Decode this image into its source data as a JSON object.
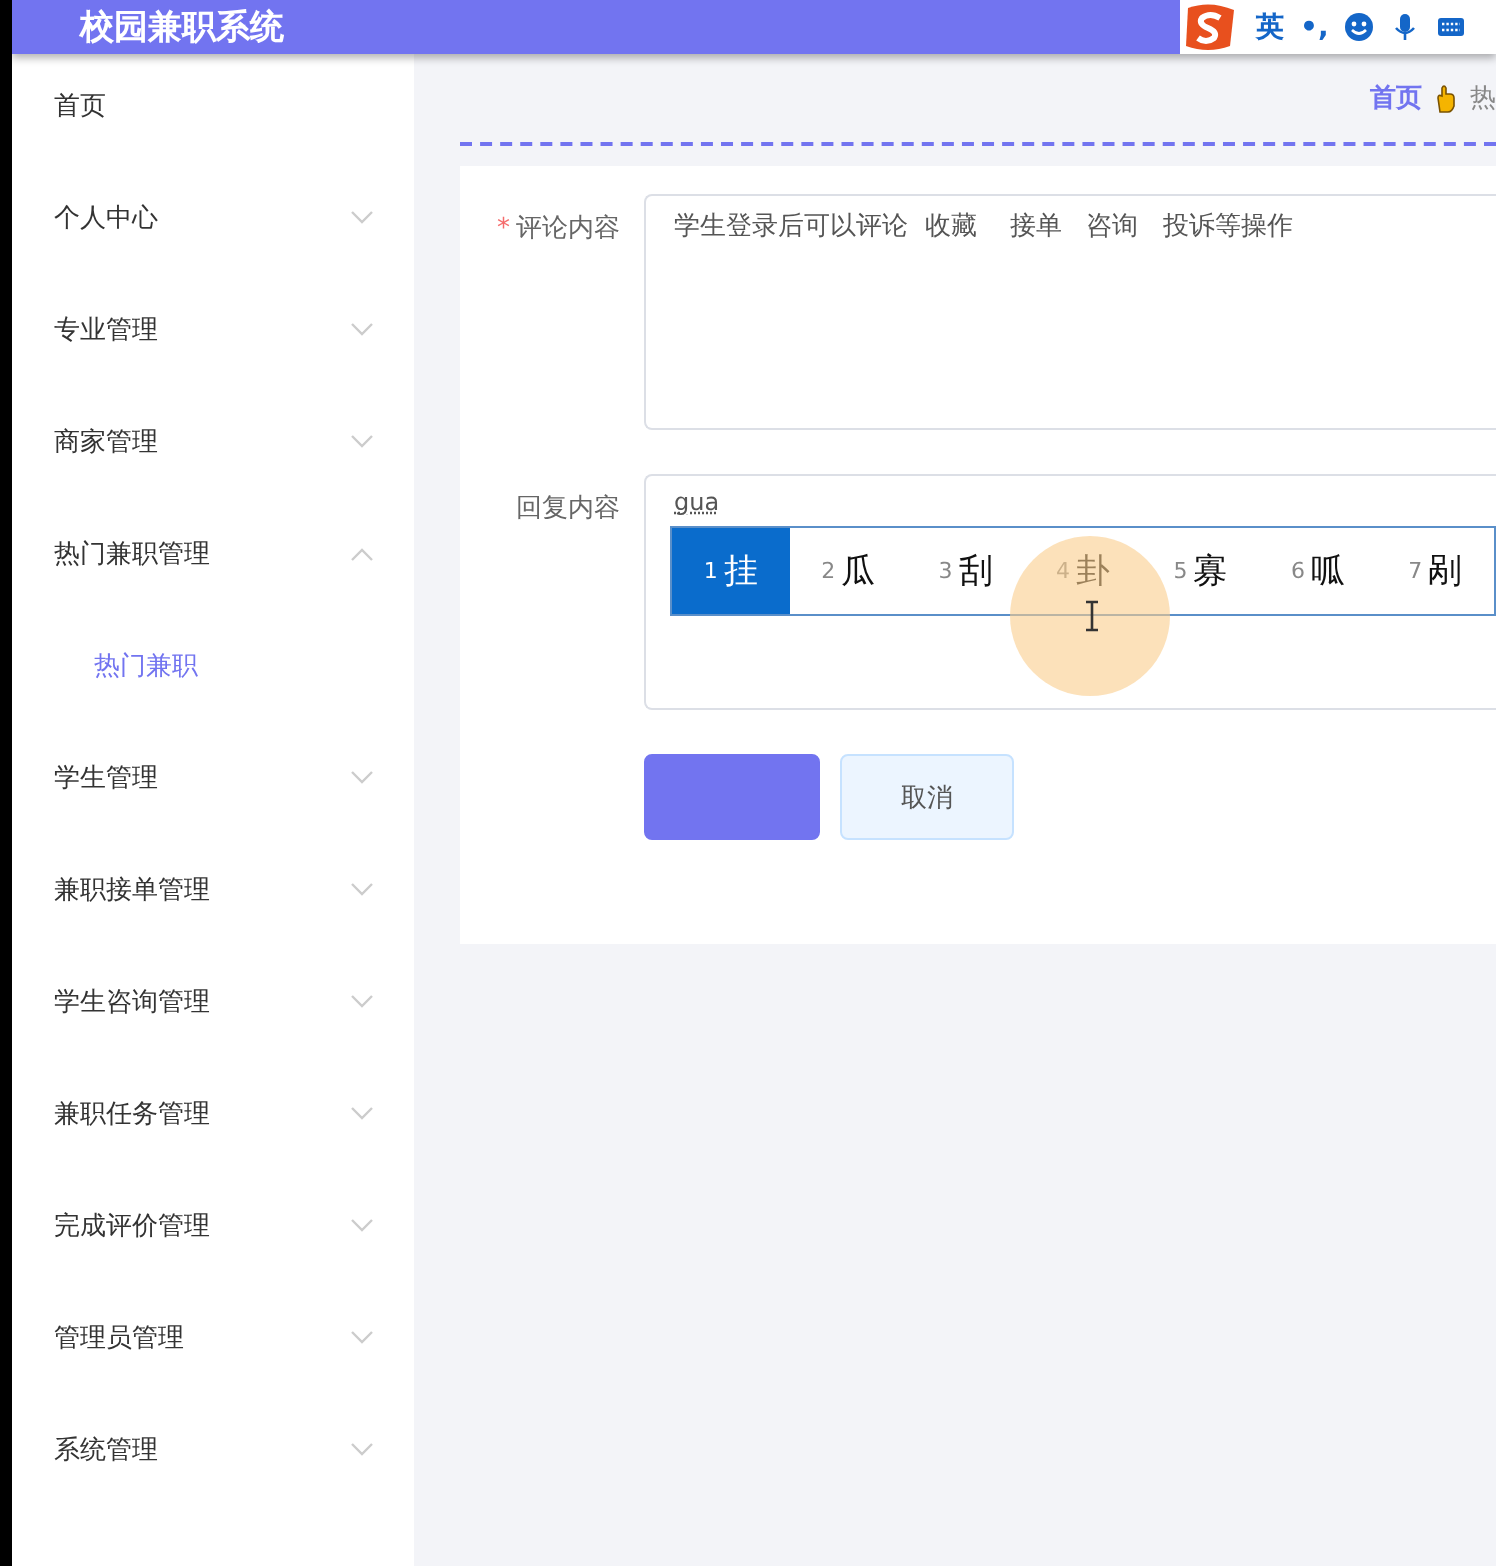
{
  "header": {
    "title": "校园兼职系统",
    "ime_toolbar": {
      "mode": "英",
      "punctuation": "•,"
    }
  },
  "sidebar": {
    "items": [
      {
        "label": "首页",
        "kind": "link"
      },
      {
        "label": "个人中心",
        "kind": "group",
        "expanded": false
      },
      {
        "label": "专业管理",
        "kind": "group",
        "expanded": false
      },
      {
        "label": "商家管理",
        "kind": "group",
        "expanded": false
      },
      {
        "label": "热门兼职管理",
        "kind": "group",
        "expanded": true,
        "children": [
          {
            "label": "热门兼职",
            "selected": true
          }
        ]
      },
      {
        "label": "学生管理",
        "kind": "group",
        "expanded": false
      },
      {
        "label": "兼职接单管理",
        "kind": "group",
        "expanded": false
      },
      {
        "label": "学生咨询管理",
        "kind": "group",
        "expanded": false
      },
      {
        "label": "兼职任务管理",
        "kind": "group",
        "expanded": false
      },
      {
        "label": "完成评价管理",
        "kind": "group",
        "expanded": false
      },
      {
        "label": "管理员管理",
        "kind": "group",
        "expanded": false
      },
      {
        "label": "系统管理",
        "kind": "group",
        "expanded": false
      }
    ]
  },
  "breadcrumb": {
    "items": [
      "首页",
      "热"
    ]
  },
  "form": {
    "fields": [
      {
        "label": "评论内容",
        "required_mark": "*",
        "value": "学生登录后可以评论  收藏    接单   咨询   投诉等操作"
      },
      {
        "label": "回复内容",
        "value": "gua"
      }
    ],
    "buttons": [
      {
        "kind": "primary"
      },
      {
        "kind": "default",
        "label": "取消"
      }
    ]
  },
  "ime_candidates": [
    {
      "index": "1",
      "text": "挂",
      "selected": true
    },
    {
      "index": "2",
      "text": "瓜",
      "selected": false
    },
    {
      "index": "3",
      "text": "刮",
      "selected": false
    },
    {
      "index": "4",
      "text": "卦",
      "selected": false
    },
    {
      "index": "5",
      "text": "寡",
      "selected": false
    },
    {
      "index": "6",
      "text": "呱",
      "selected": false
    },
    {
      "index": "7",
      "text": "剐",
      "selected": false
    }
  ]
}
